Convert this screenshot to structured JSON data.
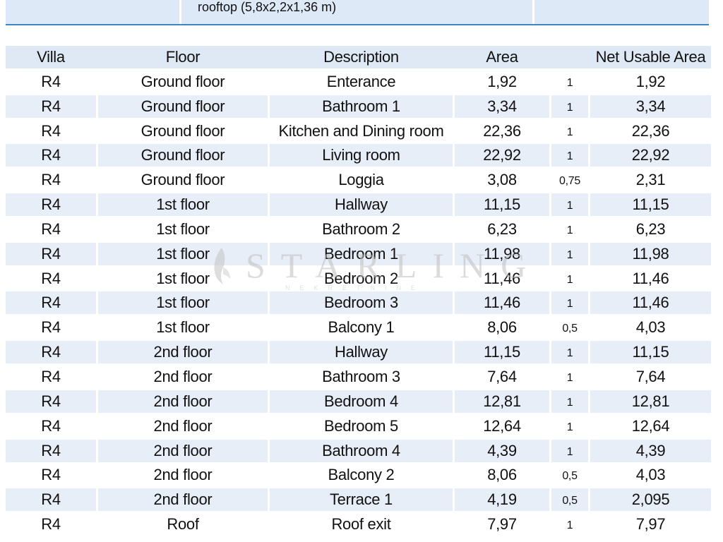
{
  "top_strip": {
    "text": "rooftop (5,8x2,2x1,36 m)"
  },
  "table": {
    "headers": {
      "villa": "Villa",
      "floor": "Floor",
      "description": "Description",
      "area": "Area",
      "factor": "",
      "net": "Net Usable Area"
    },
    "rows": [
      {
        "villa": "R4",
        "floor": "Ground floor",
        "description": "Enterance",
        "area": "1,92",
        "factor": "1",
        "net": "1,92"
      },
      {
        "villa": "R4",
        "floor": "Ground floor",
        "description": "Bathroom 1",
        "area": "3,34",
        "factor": "1",
        "net": "3,34"
      },
      {
        "villa": "R4",
        "floor": "Ground floor",
        "description": "Kitchen and Dining room",
        "area": "22,36",
        "factor": "1",
        "net": "22,36"
      },
      {
        "villa": "R4",
        "floor": "Ground floor",
        "description": "Living room",
        "area": "22,92",
        "factor": "1",
        "net": "22,92"
      },
      {
        "villa": "R4",
        "floor": "Ground floor",
        "description": "Loggia",
        "area": "3,08",
        "factor": "0,75",
        "net": "2,31"
      },
      {
        "villa": "R4",
        "floor": "1st floor",
        "description": "Hallway",
        "area": "11,15",
        "factor": "1",
        "net": "11,15"
      },
      {
        "villa": "R4",
        "floor": "1st floor",
        "description": "Bathroom 2",
        "area": "6,23",
        "factor": "1",
        "net": "6,23"
      },
      {
        "villa": "R4",
        "floor": "1st floor",
        "description": "Bedroom 1",
        "area": "11,98",
        "factor": "1",
        "net": "11,98"
      },
      {
        "villa": "R4",
        "floor": "1st floor",
        "description": "Bedroom 2",
        "area": "11,46",
        "factor": "1",
        "net": "11,46"
      },
      {
        "villa": "R4",
        "floor": "1st floor",
        "description": "Bedroom 3",
        "area": "11,46",
        "factor": "1",
        "net": "11,46"
      },
      {
        "villa": "R4",
        "floor": "1st floor",
        "description": "Balcony 1",
        "area": "8,06",
        "factor": "0,5",
        "net": "4,03"
      },
      {
        "villa": "R4",
        "floor": "2nd floor",
        "description": "Hallway",
        "area": "11,15",
        "factor": "1",
        "net": "11,15"
      },
      {
        "villa": "R4",
        "floor": "2nd floor",
        "description": "Bathroom 3",
        "area": "7,64",
        "factor": "1",
        "net": "7,64"
      },
      {
        "villa": "R4",
        "floor": "2nd floor",
        "description": "Bedroom 4",
        "area": "12,81",
        "factor": "1",
        "net": "12,81"
      },
      {
        "villa": "R4",
        "floor": "2nd floor",
        "description": "Bedroom 5",
        "area": "12,64",
        "factor": "1",
        "net": "12,64"
      },
      {
        "villa": "R4",
        "floor": "2nd floor",
        "description": "Bathroom 4",
        "area": "4,39",
        "factor": "1",
        "net": "4,39"
      },
      {
        "villa": "R4",
        "floor": "2nd floor",
        "description": "Balcony 2",
        "area": "8,06",
        "factor": "0,5",
        "net": "4,03"
      },
      {
        "villa": "R4",
        "floor": "2nd floor",
        "description": "Terrace 1",
        "area": "4,19",
        "factor": "0,5",
        "net": "2,095"
      },
      {
        "villa": "R4",
        "floor": "Roof",
        "description": "Roof exit",
        "area": "7,97",
        "factor": "1",
        "net": "7,97"
      }
    ]
  },
  "watermark": {
    "brand": "STARLING",
    "sub": "NEKRETNINE"
  },
  "colors": {
    "header_bg": "#dfe9f5",
    "alt_row_bg": "#e7eef8",
    "rule": "#3d86c6"
  }
}
